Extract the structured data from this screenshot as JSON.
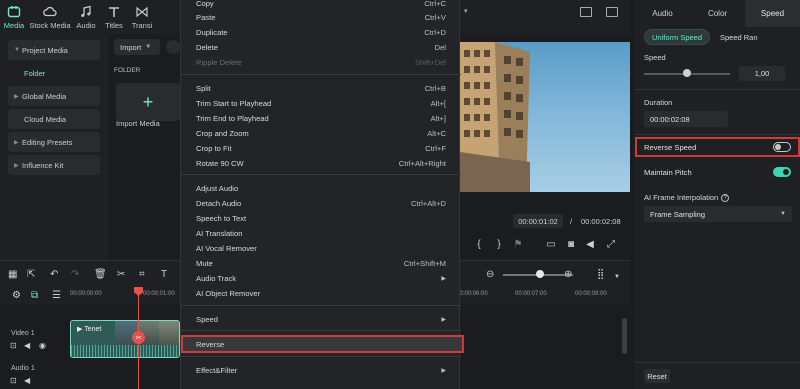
{
  "toolbar": {
    "items": [
      {
        "label": "Media",
        "icon": "media-icon"
      },
      {
        "label": "Stock Media",
        "icon": "cloud-icon"
      },
      {
        "label": "Audio",
        "icon": "music-icon"
      },
      {
        "label": "Titles",
        "icon": "text-icon"
      },
      {
        "label": "Transi",
        "icon": "transition-icon"
      }
    ]
  },
  "sidebar": {
    "items": [
      {
        "label": "Project Media"
      },
      {
        "label": "Folder"
      },
      {
        "label": "Global Media"
      },
      {
        "label": "Cloud Media"
      },
      {
        "label": "Editing Presets"
      },
      {
        "label": "Influence Kit"
      }
    ]
  },
  "media": {
    "import_label": "Import",
    "folder_header": "FOLDER",
    "import_tile_plus": "+",
    "import_caption": "Import Media"
  },
  "context_menu": {
    "items": [
      {
        "label": "Copy",
        "shortcut": "Ctrl+C"
      },
      {
        "label": "Paste",
        "shortcut": "Ctrl+V"
      },
      {
        "label": "Duplicate",
        "shortcut": "Ctrl+D"
      },
      {
        "label": "Delete",
        "shortcut": "Del"
      },
      {
        "label": "Ripple Delete",
        "shortcut": "Shift+Del",
        "disabled": true
      },
      {
        "label": "Split",
        "shortcut": "Ctrl+B"
      },
      {
        "label": "Trim Start to Playhead",
        "shortcut": "Alt+["
      },
      {
        "label": "Trim End to Playhead",
        "shortcut": "Alt+]"
      },
      {
        "label": "Crop and Zoom",
        "shortcut": "Alt+C"
      },
      {
        "label": "Crop to Fit",
        "shortcut": "Ctrl+F"
      },
      {
        "label": "Rotate 90 CW",
        "shortcut": "Ctrl+Alt+Right"
      },
      {
        "label": "Adjust Audio",
        "shortcut": ""
      },
      {
        "label": "Detach Audio",
        "shortcut": "Ctrl+Alt+D"
      },
      {
        "label": "Speech to Text",
        "shortcut": ""
      },
      {
        "label": "AI Translation",
        "shortcut": ""
      },
      {
        "label": "AI Vocal Remover",
        "shortcut": ""
      },
      {
        "label": "Mute",
        "shortcut": "Ctrl+Shift+M"
      },
      {
        "label": "Audio Track",
        "shortcut": "",
        "submenu": true
      },
      {
        "label": "AI Object Remover",
        "shortcut": ""
      },
      {
        "label": "Speed",
        "shortcut": "",
        "submenu": true
      },
      {
        "label": "Reverse",
        "shortcut": ""
      },
      {
        "label": "Effect&Filter",
        "shortcut": "",
        "submenu": true
      }
    ]
  },
  "preview": {
    "current_time": "00:00:01:02",
    "separator": "/",
    "total_time": "00:00:02:08"
  },
  "right_panel": {
    "tabs": [
      "Audio",
      "Color",
      "Speed"
    ],
    "active_tab": "Speed",
    "segments": [
      "Uniform Speed",
      "Speed Ran"
    ],
    "speed_label": "Speed",
    "speed_value": "1,00",
    "speed_slider_fraction": 0.5,
    "duration_label": "Duration",
    "duration_value": "00:00:02:08",
    "reverse_speed_label": "Reverse Speed",
    "reverse_speed_on": false,
    "maintain_pitch_label": "Maintain Pitch",
    "maintain_pitch_on": true,
    "ai_interp_label": "AI Frame Interpolation",
    "ai_interp_value": "Frame Sampling",
    "reset_label": "Reset"
  },
  "timeline": {
    "ruler_left": [
      "00:00:00:00",
      "00:00:01:00"
    ],
    "ruler_right": [
      "00:00:06:00",
      "00:00:07:00",
      "00:00:08:00"
    ],
    "video_track_label": "Video 1",
    "audio_track_label": "Audio 1",
    "clip_name": "Tenet"
  },
  "colors": {
    "accent": "#6ee8cf",
    "highlight_border": "#d03a3a",
    "playhead": "#e4524c"
  }
}
